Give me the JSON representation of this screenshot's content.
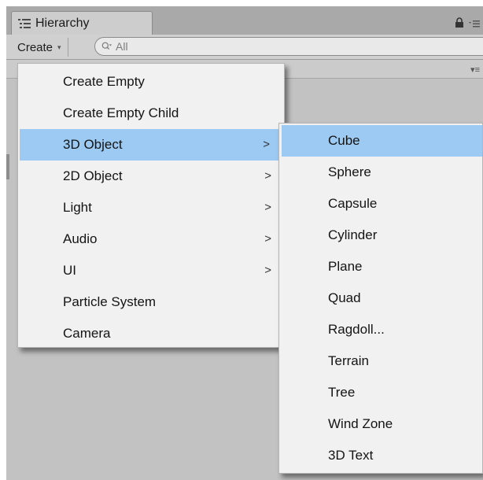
{
  "window": {
    "tab_title": "Hierarchy",
    "tab_icon": "hierarchy-list-icon",
    "lock_icon": "lock-icon",
    "options_icon": "context-menu-icon"
  },
  "toolbar": {
    "create_label": "Create",
    "create_caret": "▾",
    "search_placeholder": "All",
    "search_icon": "search-icon"
  },
  "create_menu": {
    "items": [
      {
        "label": "Create Empty",
        "has_submenu": false
      },
      {
        "label": "Create Empty Child",
        "has_submenu": false
      },
      {
        "label": "3D Object",
        "has_submenu": true,
        "selected": true
      },
      {
        "label": "2D Object",
        "has_submenu": true
      },
      {
        "label": "Light",
        "has_submenu": true
      },
      {
        "label": "Audio",
        "has_submenu": true
      },
      {
        "label": "UI",
        "has_submenu": true
      },
      {
        "label": "Particle System",
        "has_submenu": false
      },
      {
        "label": "Camera",
        "has_submenu": false
      }
    ],
    "arrow": ">"
  },
  "object_3d_menu": {
    "items": [
      {
        "label": "Cube",
        "selected": true
      },
      {
        "label": "Sphere"
      },
      {
        "label": "Capsule"
      },
      {
        "label": "Cylinder"
      },
      {
        "label": "Plane"
      },
      {
        "label": "Quad"
      },
      {
        "label": "Ragdoll..."
      },
      {
        "label": "Terrain"
      },
      {
        "label": "Tree"
      },
      {
        "label": "Wind Zone"
      },
      {
        "label": "3D Text"
      }
    ]
  },
  "colors": {
    "selection": "#9ccaf3",
    "menu_background": "#f1f1f1",
    "panel_background": "#c2c2c2"
  }
}
